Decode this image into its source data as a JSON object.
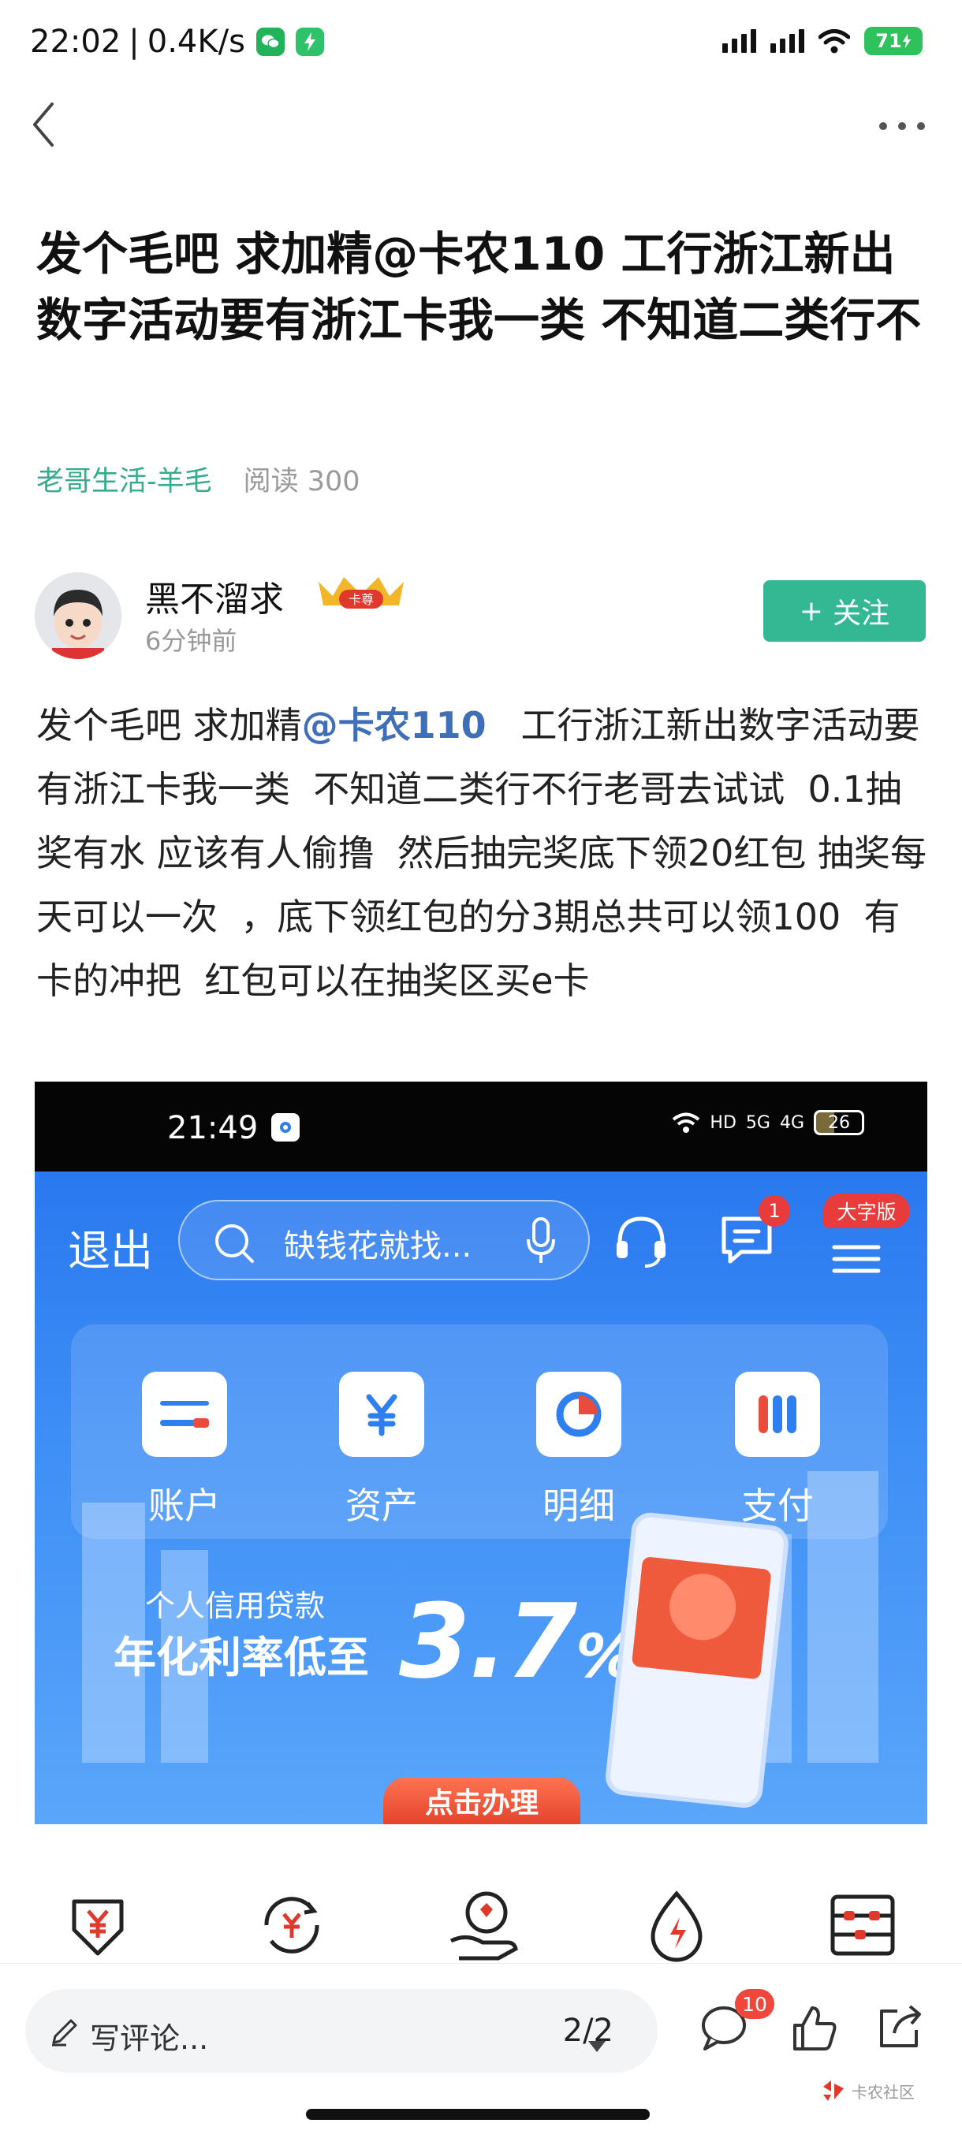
{
  "status_bar": {
    "time": "22:02",
    "separator": "|",
    "net_speed": "0.4K/s",
    "battery": "71"
  },
  "post": {
    "title": "发个毛吧 求加精@卡农110 工行浙江新出数字活动要有浙江卡我一类 不知道二类行不",
    "category": "老哥生活-羊毛",
    "reads": "阅读 300",
    "author": {
      "name": "黑不溜求",
      "badge": "卡尊",
      "time": "6分钟前",
      "follow_plus": "+",
      "follow_label": "关注"
    },
    "body_before": "发个毛吧 求加精",
    "mention": "@卡农110",
    "body_after": "   工行浙江新出数字活动要有浙江卡我一类  不知道二类行不行老哥去试试  0.1抽奖有水 应该有人偷撸  然后抽完奖底下领20红包 抽奖每天可以一次  ，底下领红包的分3期总共可以领100  有卡的冲把  红包可以在抽奖区买e卡"
  },
  "screenshot": {
    "time": "21:49",
    "net_labels": [
      "HD",
      "5G",
      "4G"
    ],
    "battery": "26",
    "exit_label": "退出",
    "search_placeholder": "缺钱花就找...",
    "message_badge": "1",
    "large_font_label": "大字版",
    "quick_actions": [
      {
        "label": "账户",
        "icon": "account-card-icon"
      },
      {
        "label": "资产",
        "icon": "yuan-asset-icon"
      },
      {
        "label": "明细",
        "icon": "pie-detail-icon"
      },
      {
        "label": "支付",
        "icon": "pay-bars-icon"
      }
    ],
    "banner": {
      "subtitle": "个人信用贷款",
      "headline": "年化利率低至",
      "rate_number": "3.7",
      "rate_unit": "%",
      "cta": "点击办理"
    },
    "bottom_icons": [
      "yuan-down-icon",
      "yuan-exchange-icon",
      "hand-gift-icon",
      "flame-drop-icon",
      "abacus-icon"
    ]
  },
  "bottom_bar": {
    "comment_placeholder": "写评论...",
    "page_indicator": "2/2",
    "comment_count": "10",
    "watermark": "卡农社区"
  },
  "colors": {
    "accent_green": "#33b893",
    "category_teal": "#33ad8c",
    "mention_blue": "#3f6fb6",
    "badge_red": "#f0463c",
    "bank_blue": "#2f7ff0"
  }
}
